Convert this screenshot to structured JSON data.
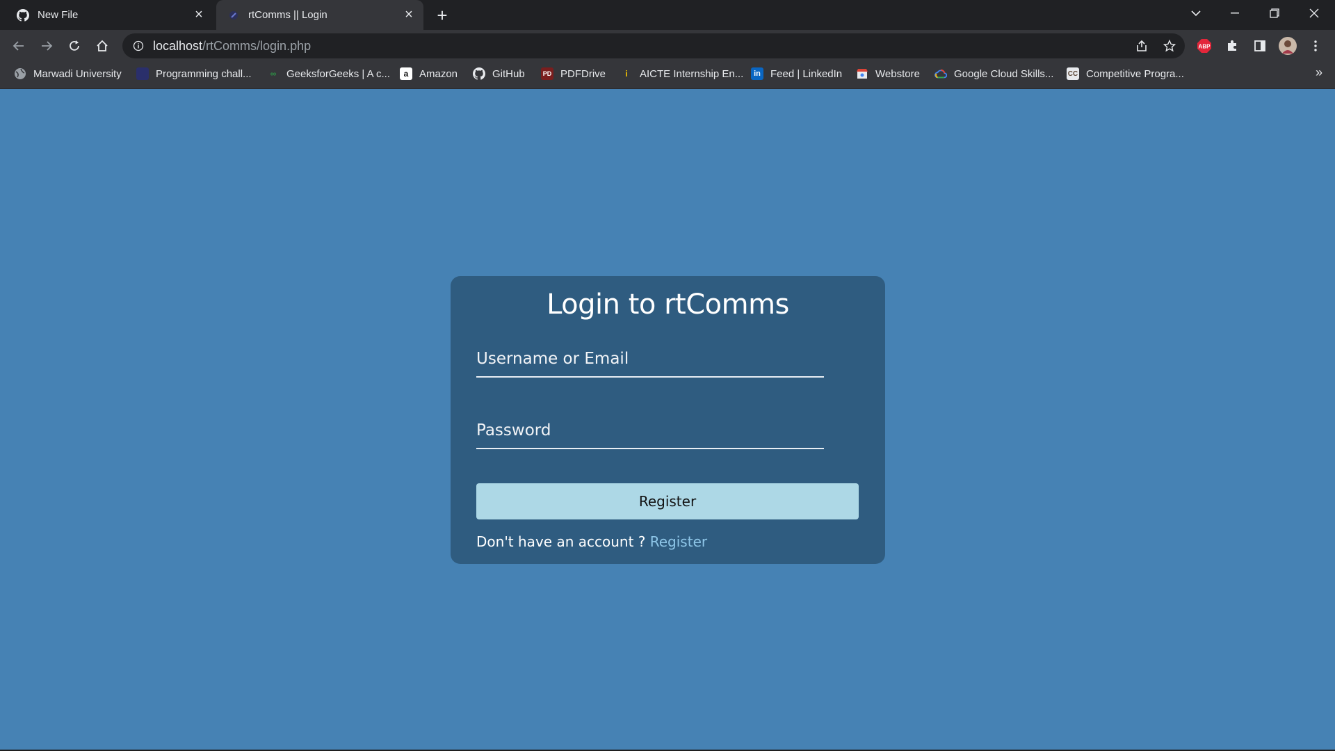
{
  "tabs": [
    {
      "title": "New File",
      "icon": "github-icon",
      "active": false
    },
    {
      "title": "rtComms || Login",
      "icon": "rtcomms-favicon",
      "active": true
    }
  ],
  "address": {
    "host": "localhost",
    "path": "/rtComms/login.php"
  },
  "bookmarks": [
    {
      "label": "Marwadi University",
      "icon": "globe-icon"
    },
    {
      "label": "Programming chall...",
      "icon": "square-icon"
    },
    {
      "label": "GeeksforGeeks | A c...",
      "icon": "gfg-icon"
    },
    {
      "label": "Amazon",
      "icon": "amazon-icon"
    },
    {
      "label": "GitHub",
      "icon": "github-icon"
    },
    {
      "label": "PDFDrive",
      "icon": "pdf-icon"
    },
    {
      "label": "AICTE Internship En...",
      "icon": "aicte-icon"
    },
    {
      "label": "Feed | LinkedIn",
      "icon": "linkedin-icon"
    },
    {
      "label": "Webstore",
      "icon": "webstore-icon"
    },
    {
      "label": "Google Cloud Skills...",
      "icon": "google-cloud-icon"
    },
    {
      "label": "Competitive Progra...",
      "icon": "cc-icon"
    }
  ],
  "extensions": {
    "abp_label": "ABP"
  },
  "login": {
    "title": "Login to rtComms",
    "username_placeholder": "Username or Email",
    "password_placeholder": "Password",
    "button_label": "Register",
    "footer_text": "Don't have an account ? ",
    "footer_link": "Register"
  },
  "colors": {
    "page_bg": "#4682b4",
    "card_bg": "#2f5c80",
    "button_bg": "#add8e6",
    "link": "#8ec6e8"
  }
}
